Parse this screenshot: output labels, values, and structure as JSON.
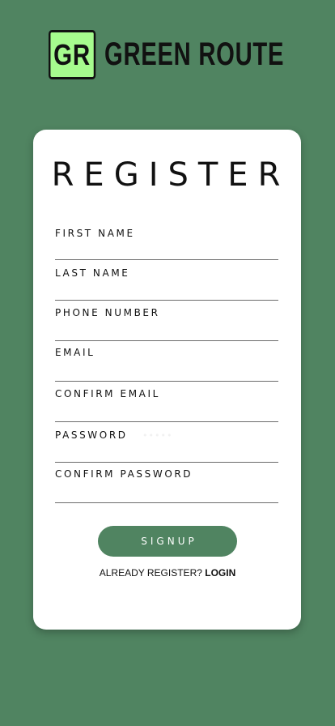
{
  "brand": {
    "badge": "GR",
    "name": "GREEN ROUTE"
  },
  "form": {
    "title": "REGISTER",
    "fields": [
      {
        "label": "FIRST NAME",
        "value": "",
        "placeholder": ""
      },
      {
        "label": "LAST NAME",
        "value": "",
        "placeholder": ""
      },
      {
        "label": "PHONE NUMBER",
        "value": "",
        "placeholder": ""
      },
      {
        "label": "EMAIL",
        "value": "",
        "placeholder": ""
      },
      {
        "label": "CONFIRM EMAIL",
        "value": "",
        "placeholder": ""
      },
      {
        "label": "PASSWORD",
        "value": "",
        "placeholder": "•••••"
      },
      {
        "label": "CONFIRM PASSWORD",
        "value": "",
        "placeholder": ""
      }
    ],
    "submit_label": "SIGNUP",
    "already_text": "ALREADY REGISTER?",
    "login_label": "LOGIN"
  },
  "colors": {
    "background": "#508461",
    "badge": "#a6fb8e",
    "card": "#ffffff",
    "button": "#508461"
  }
}
